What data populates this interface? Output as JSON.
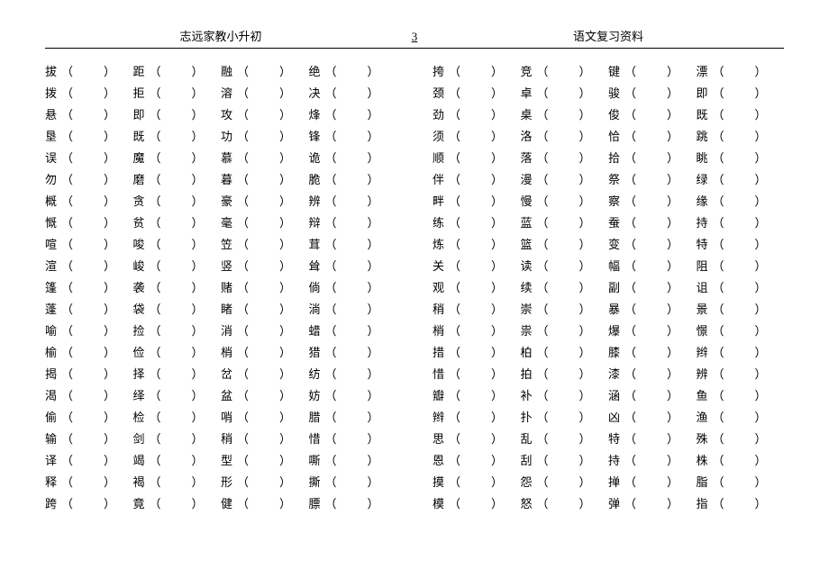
{
  "header": {
    "left": "志远家教小升初",
    "page_no": "3",
    "right": "语文复习资料"
  },
  "paren": {
    "open": "（",
    "close": "）"
  },
  "left_block": [
    [
      "拔",
      "距",
      "融",
      "绝"
    ],
    [
      "拨",
      "拒",
      "溶",
      "决"
    ],
    [
      "悬",
      "即",
      "攻",
      "烽"
    ],
    [
      "垦",
      "既",
      "功",
      "锋"
    ],
    [
      "误",
      "魔",
      "慕",
      "诡"
    ],
    [
      "勿",
      "磨",
      "暮",
      "脆"
    ],
    [
      "概",
      "贪",
      "豪",
      "辨"
    ],
    [
      "慨",
      "贫",
      "毫",
      "辩"
    ],
    [
      "喧",
      "唆",
      "笠",
      "茸"
    ],
    [
      "渲",
      "峻",
      "竖",
      "耸"
    ],
    [
      "篷",
      "袭",
      "赌",
      "倘"
    ],
    [
      "蓬",
      "袋",
      "睹",
      "淌"
    ],
    [
      "喻",
      "捡",
      "消",
      "蜡"
    ],
    [
      "榆",
      "俭",
      "梢",
      "猎"
    ],
    [
      "揭",
      "择",
      "岔",
      "纺"
    ],
    [
      "渴",
      "绎",
      "盆",
      "妨"
    ],
    [
      "偷",
      "检",
      "哨",
      "腊"
    ],
    [
      "输",
      "剑",
      "稍",
      "惜"
    ],
    [
      "译",
      "竭",
      "型",
      "嘶"
    ],
    [
      "释",
      "褐",
      "形",
      "撕"
    ],
    [
      "跨",
      "竟",
      "健",
      "膘"
    ]
  ],
  "right_block": [
    [
      "挎",
      "竞",
      "键",
      "漂"
    ],
    [
      "颈",
      "卓",
      "骏",
      "即"
    ],
    [
      "劲",
      "桌",
      "俊",
      "既"
    ],
    [
      "须",
      "洛",
      "恰",
      "跳"
    ],
    [
      "顺",
      "落",
      "拾",
      "眺"
    ],
    [
      "伴",
      "漫",
      "祭",
      "绿"
    ],
    [
      "畔",
      "慢",
      "察",
      "缘"
    ],
    [
      "练",
      "蓝",
      "蚕",
      "持"
    ],
    [
      "炼",
      "篮",
      "变",
      "特"
    ],
    [
      "关",
      "读",
      "幅",
      "阻"
    ],
    [
      "观",
      "续",
      "副",
      "诅"
    ],
    [
      "稍",
      "崇",
      "暴",
      "景"
    ],
    [
      "梢",
      "祟",
      "爆",
      "憬"
    ],
    [
      "措",
      "柏",
      "膝",
      "辫"
    ],
    [
      "惜",
      "拍",
      "漆",
      "辨"
    ],
    [
      "瓣",
      "补",
      "涵",
      "鱼"
    ],
    [
      "辫",
      "扑",
      "凶",
      "渔"
    ],
    [
      "思",
      "乱",
      "特",
      "殊"
    ],
    [
      "恩",
      "刮",
      "持",
      "株"
    ],
    [
      "摸",
      "怨",
      "掸",
      "脂"
    ],
    [
      "模",
      "怒",
      "弹",
      "指"
    ]
  ]
}
